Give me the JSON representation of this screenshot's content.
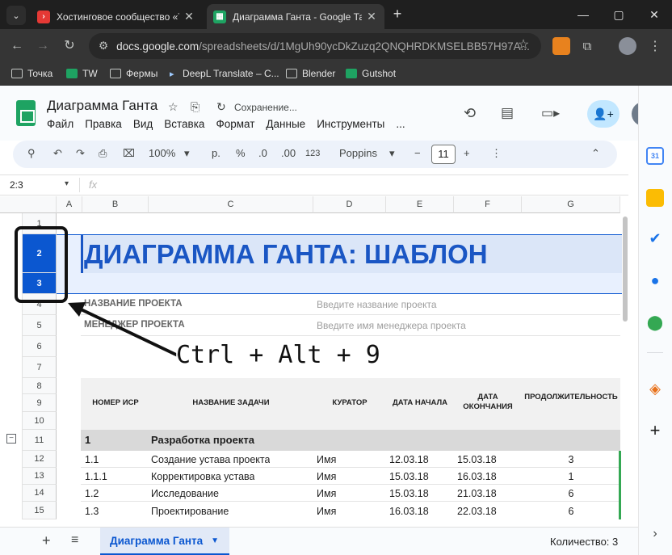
{
  "browser": {
    "tabs": [
      {
        "title": "Хостинговое сообщество «Tim",
        "favicon": "play-icon",
        "active": false
      },
      {
        "title": "Диаграмма Ганта - Google Таб",
        "favicon": "sheets-icon",
        "active": true
      }
    ],
    "url_main": "docs.google.com",
    "url_rest": "/spreadsheets/d/1MgUh90ycDkZuzq2QNQHRDKMSELBB57H97A...",
    "bookmarks": [
      "Точка",
      "TW",
      "Фермы",
      "DeepL Translate – С...",
      "Blender",
      "Gutshot"
    ],
    "window_controls": {
      "minimize": "—",
      "maximize": "▢",
      "close": "✕"
    }
  },
  "doc": {
    "title": "Диаграмма Ганта",
    "status": "Сохранение...",
    "menu": [
      "Файл",
      "Правка",
      "Вид",
      "Вставка",
      "Формат",
      "Данные",
      "Инструменты",
      "..."
    ]
  },
  "toolbar": {
    "zoom": "100%",
    "currency": "р.",
    "percent": "%",
    "dec_decrease": ".0",
    "dec_increase": ".00",
    "format_123": "123",
    "font": "Poppins",
    "font_size": "11",
    "minus": "−",
    "plus": "+"
  },
  "formula_bar": {
    "name_box": "2:3",
    "fx": "fx"
  },
  "columns": [
    "A",
    "B",
    "C",
    "D",
    "E",
    "F",
    "G"
  ],
  "rows": [
    "1",
    "2",
    "3",
    "4",
    "5",
    "6",
    "7",
    "8",
    "9",
    "10",
    "11",
    "12",
    "13",
    "14",
    "15"
  ],
  "sheet": {
    "banner": "ДИАГРАММА ГАНТА: ШАБЛОН",
    "project_name_label": "НАЗВАНИЕ ПРОЕКТА",
    "project_name_placeholder": "Введите название проекта",
    "manager_label": "МЕНЕДЖЕР ПРОЕКТА",
    "manager_placeholder": "Введите имя менеджера проекта",
    "headers": [
      "НОМЕР ИСР",
      "НАЗВАНИЕ ЗАДАЧИ",
      "КУРАТОР",
      "ДАТА НАЧАЛА",
      "ДАТА ОКОНЧАНИЯ",
      "ПРОДОЛЖИТЕЛЬНОСТЬ"
    ],
    "section": {
      "id": "1",
      "name": "Разработка проекта"
    },
    "tasks": [
      {
        "id": "1.1",
        "name": "Создание устава проекта",
        "owner": "Имя",
        "start": "12.03.18",
        "end": "15.03.18",
        "duration": "3"
      },
      {
        "id": "1.1.1",
        "name": "Корректировка устава",
        "owner": "Имя",
        "start": "15.03.18",
        "end": "16.03.18",
        "duration": "1"
      },
      {
        "id": "1.2",
        "name": "Исследование",
        "owner": "Имя",
        "start": "15.03.18",
        "end": "21.03.18",
        "duration": "6"
      },
      {
        "id": "1.3",
        "name": "Проектирование",
        "owner": "Имя",
        "start": "16.03.18",
        "end": "22.03.18",
        "duration": "6"
      }
    ]
  },
  "annotation": {
    "shortcut": "Ctrl + Alt + 9"
  },
  "bottom": {
    "add": "+",
    "sheet_tab": "Диаграмма Ганта",
    "count": "Количество: 3"
  }
}
